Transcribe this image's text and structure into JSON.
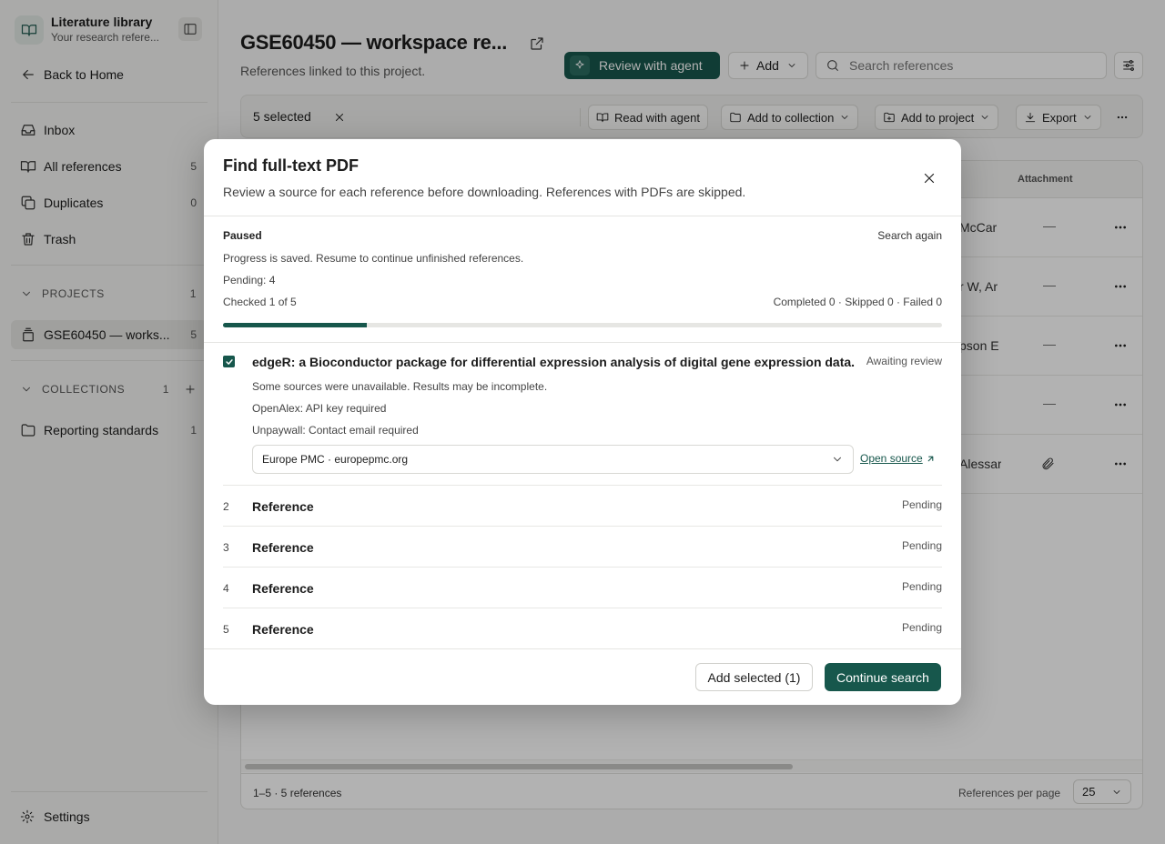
{
  "sidebar": {
    "brand_title": "Literature library",
    "brand_subtitle": "Your research refere...",
    "back_label": "Back to Home",
    "nav": [
      {
        "label": "Inbox",
        "count": ""
      },
      {
        "label": "All references",
        "count": "5"
      },
      {
        "label": "Duplicates",
        "count": "0"
      },
      {
        "label": "Trash",
        "count": ""
      }
    ],
    "projects_label": "PROJECTS",
    "projects_count": "1",
    "project_item": {
      "label": "GSE60450 — works...",
      "count": "5"
    },
    "collections_label": "COLLECTIONS",
    "collections_count": "1",
    "collection_item": {
      "label": "Reporting standards",
      "count": "1"
    },
    "settings_label": "Settings"
  },
  "header": {
    "title": "GSE60450 — workspace re...",
    "subtitle": "References linked to this project.",
    "review_agent_label": "Review with agent",
    "add_label": "Add",
    "search_placeholder": "Search references"
  },
  "selection_bar": {
    "count_label": "5 selected",
    "read_agent": "Read with agent",
    "add_collection": "Add to collection",
    "add_project": "Add to project",
    "export": "Export"
  },
  "table": {
    "attachment_header": "Attachment",
    "rows": [
      {
        "authors": "McCar",
        "attachment": "—"
      },
      {
        "authors": "r W, Ar",
        "attachment": "—"
      },
      {
        "authors": "pson E",
        "attachment": "—"
      },
      {
        "authors": "",
        "attachment": "—"
      },
      {
        "authors": "Alessar",
        "attachment": "paperclip"
      }
    ],
    "range_label": "1–5 · 5 references",
    "per_page_label": "References per page",
    "per_page_value": "25"
  },
  "modal": {
    "title": "Find full-text PDF",
    "subtitle": "Review a source for each reference before downloading. References with PDFs are skipped.",
    "status": "Paused",
    "search_again": "Search again",
    "status_note": "Progress is saved. Resume to continue unfinished references.",
    "pending_line": "Pending: 4",
    "checked_line": "Checked 1 of 5",
    "summary_line": "Completed 0 · Skipped 0 · Failed 0",
    "progress_fraction": 0.2,
    "first_ref": {
      "title": "edgeR: a Bioconductor package for differential expression analysis of digital gene expression data.",
      "status": "Awaiting review",
      "warning": "Some sources were unavailable. Results may be incomplete.",
      "openalex": "OpenAlex: API key required",
      "unpaywall": "Unpaywall: Contact email required",
      "source_value": "Europe PMC · europepmc.org",
      "open_source_label": "Open source"
    },
    "pending_refs": [
      {
        "num": "2",
        "label": "Reference",
        "status": "Pending"
      },
      {
        "num": "3",
        "label": "Reference",
        "status": "Pending"
      },
      {
        "num": "4",
        "label": "Reference",
        "status": "Pending"
      },
      {
        "num": "5",
        "label": "Reference",
        "status": "Pending"
      }
    ],
    "add_selected_label": "Add selected (1)",
    "continue_label": "Continue search"
  },
  "colors": {
    "accent": "#17574c",
    "overlay": "rgba(0,0,0,0.30)"
  }
}
